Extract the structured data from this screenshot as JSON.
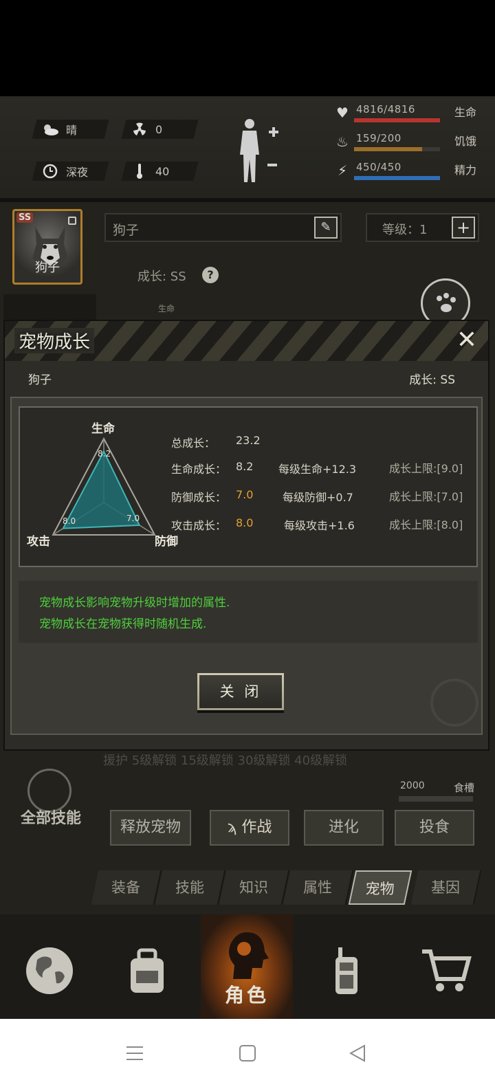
{
  "status": {
    "weather": {
      "label": "晴",
      "icon": "cloud-sun-icon"
    },
    "radiation": {
      "value": "0",
      "icon": "radiation-icon"
    },
    "time": {
      "label": "深夜",
      "icon": "clock-icon"
    },
    "temperature": {
      "value": "40",
      "icon": "thermometer-icon"
    }
  },
  "vitals": [
    {
      "name": "生命",
      "value": "4816/4816",
      "icon": "heart-icon",
      "fill": 1.0,
      "color": "#b8352f"
    },
    {
      "name": "饥饿",
      "value": "159/200",
      "icon": "hunger-icon",
      "fill": 0.795,
      "color": "#9b6f2a"
    },
    {
      "name": "精力",
      "value": "450/450",
      "icon": "energy-icon",
      "fill": 1.0,
      "color": "#2f6db5"
    }
  ],
  "pet": {
    "badge": "SS",
    "avatar_name": "狗子",
    "name_field": "狗子",
    "level_label": "等级：1",
    "growth_label": "成长: SS",
    "faint_label": "生命"
  },
  "modal": {
    "title": "宠物成长",
    "pet_name": "狗子",
    "growth_rank": "成长: SS",
    "radar": {
      "label_top": "生命",
      "label_left": "攻击",
      "label_right": "防御",
      "values": {
        "life": "8.2",
        "attack": "8.0",
        "defense": "7.0"
      },
      "fill": {
        "life": 0.8,
        "attack": 0.8,
        "defense": 0.7
      }
    },
    "stats": {
      "total_label": "总成长：",
      "total_value": "23.2",
      "rows": [
        {
          "label": "生命成长：",
          "value": "8.2",
          "per_level": "每级生命+12.3",
          "limit": "成长上限:[9.0]"
        },
        {
          "label": "防御成长：",
          "value": "7.0",
          "per_level": "每级防御+0.7",
          "limit": "成长上限:[7.0]"
        },
        {
          "label": "攻击成长：",
          "value": "8.0",
          "per_level": "每级攻击+1.6",
          "limit": "成长上限:[8.0]"
        }
      ]
    },
    "notes": [
      "宠物成长影响宠物升级时增加的属性.",
      "宠物成长在宠物获得时随机生成."
    ],
    "close_button": "关 闭"
  },
  "unlock_row": "援护  5级解锁  15级解锁  30级解锁  40级解锁",
  "all_skills": "全部技能",
  "food": {
    "value": "2000",
    "label": "食槽"
  },
  "actions": [
    "释放宠物",
    "作战",
    "进化",
    "投食"
  ],
  "tabs": [
    "装备",
    "技能",
    "知识",
    "属性",
    "宠物",
    "基因"
  ],
  "active_tab": "宠物",
  "bottom_nav": [
    {
      "icon": "globe-icon",
      "label": ""
    },
    {
      "icon": "backpack-icon",
      "label": ""
    },
    {
      "icon": "character-head-icon",
      "label": "角色"
    },
    {
      "icon": "walkie-talkie-icon",
      "label": ""
    },
    {
      "icon": "shopping-cart-icon",
      "label": ""
    }
  ]
}
